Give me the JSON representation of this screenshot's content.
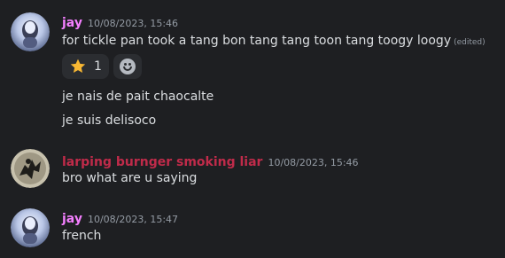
{
  "colors": {
    "background": "#1e1f22",
    "jay_name": "#f47fff",
    "liar_name": "#c02b4a",
    "timestamp": "#949ba4",
    "text": "#dbdee1"
  },
  "messages": [
    {
      "author": "jay",
      "timestamp": "10/08/2023, 15:46",
      "avatar": "jay-avatar",
      "lines": [
        "for tickle pan took a tang bon tang tang toon tang toogy loogy",
        "je nais de pait chaocalte",
        "je suis delisoco"
      ],
      "edited_label": "(edited)",
      "reactions": [
        {
          "emoji": "star-icon",
          "count": "1"
        }
      ]
    },
    {
      "author": "larping burnger smoking liar",
      "timestamp": "10/08/2023, 15:46",
      "avatar": "liar-avatar",
      "lines": [
        "bro what are u saying"
      ]
    },
    {
      "author": "jay",
      "timestamp": "10/08/2023, 15:47",
      "avatar": "jay-avatar",
      "lines": [
        "french"
      ]
    }
  ]
}
